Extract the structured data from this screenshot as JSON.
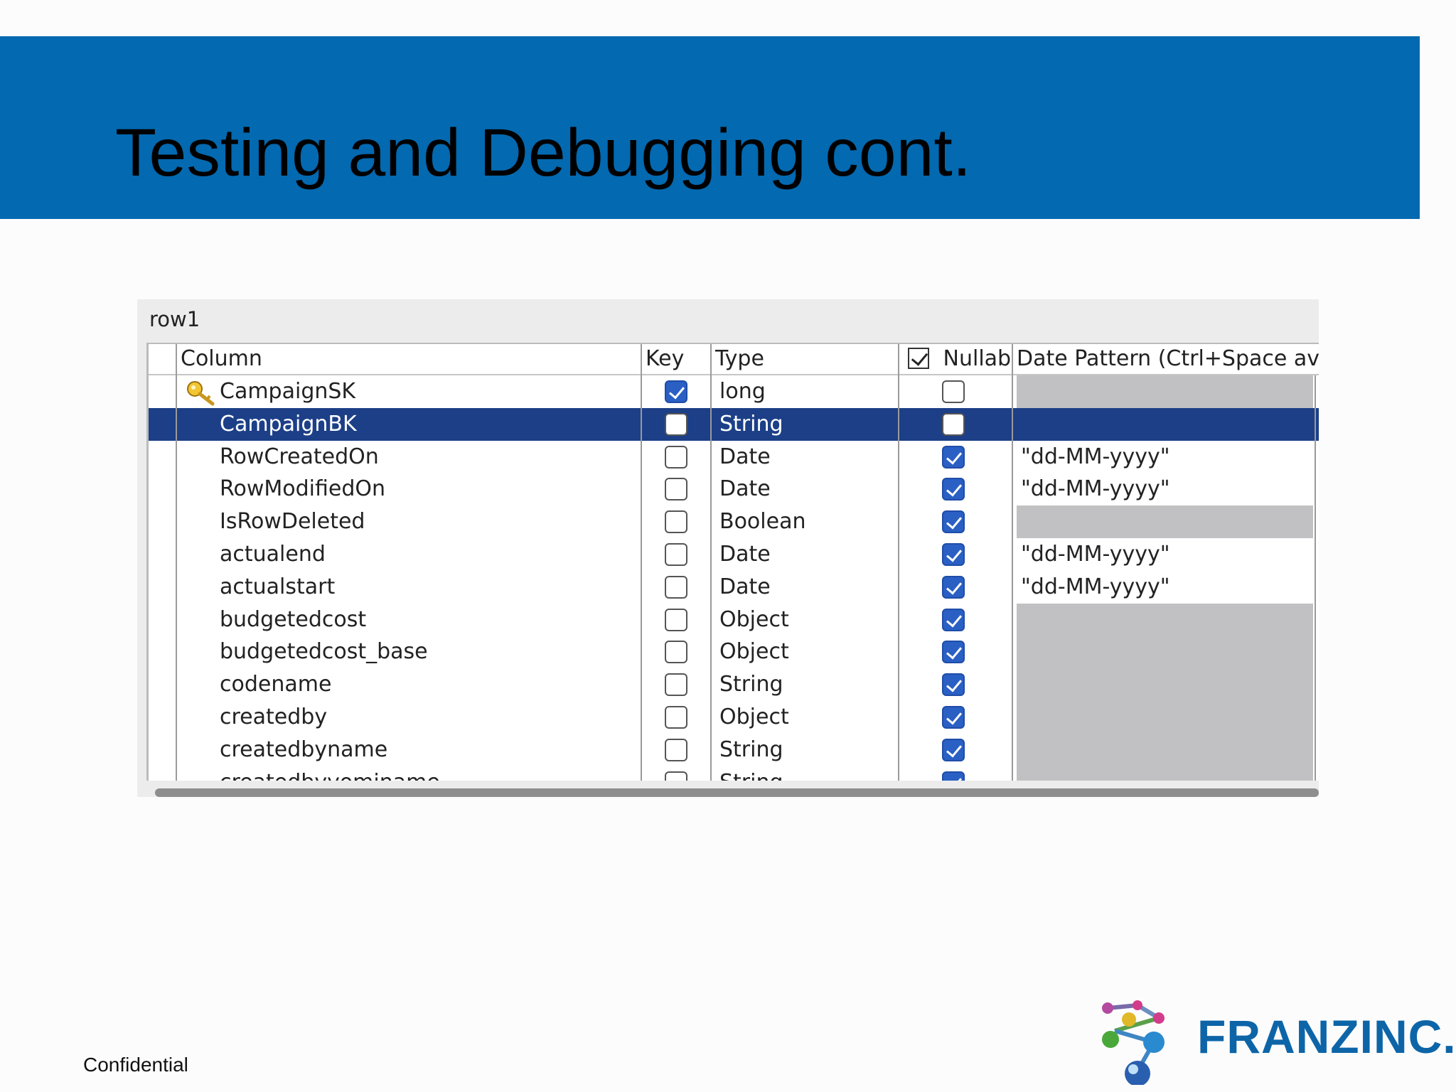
{
  "slide": {
    "title": "Testing and Debugging cont.",
    "footer": "Confidential",
    "logo_text": "FRANZINC."
  },
  "schema_panel": {
    "title": "row1",
    "columns": {
      "column": "Column",
      "key": "Key",
      "type": "Type",
      "nullable": "Nullab",
      "date_pattern": "Date Pattern (Ctrl+Space av"
    },
    "rows": [
      {
        "name": "CampaignSK",
        "key": true,
        "type": "long",
        "nullable": false,
        "date_pattern": "",
        "key_icon": "key-icon"
      },
      {
        "name": "CampaignBK",
        "key": false,
        "type": "String",
        "nullable": false,
        "date_pattern": "",
        "selected": true
      },
      {
        "name": "RowCreatedOn",
        "key": false,
        "type": "Date",
        "nullable": true,
        "date_pattern": "\"dd-MM-yyyy\""
      },
      {
        "name": "RowModifiedOn",
        "key": false,
        "type": "Date",
        "nullable": true,
        "date_pattern": "\"dd-MM-yyyy\""
      },
      {
        "name": "IsRowDeleted",
        "key": false,
        "type": "Boolean",
        "nullable": true,
        "date_pattern": ""
      },
      {
        "name": "actualend",
        "key": false,
        "type": "Date",
        "nullable": true,
        "date_pattern": "\"dd-MM-yyyy\""
      },
      {
        "name": "actualstart",
        "key": false,
        "type": "Date",
        "nullable": true,
        "date_pattern": "\"dd-MM-yyyy\""
      },
      {
        "name": "budgetedcost",
        "key": false,
        "type": "Object",
        "nullable": true,
        "date_pattern": ""
      },
      {
        "name": "budgetedcost_base",
        "key": false,
        "type": "Object",
        "nullable": true,
        "date_pattern": ""
      },
      {
        "name": "codename",
        "key": false,
        "type": "String",
        "nullable": true,
        "date_pattern": ""
      },
      {
        "name": "createdby",
        "key": false,
        "type": "Object",
        "nullable": true,
        "date_pattern": ""
      },
      {
        "name": "createdbyname",
        "key": false,
        "type": "String",
        "nullable": true,
        "date_pattern": ""
      },
      {
        "name": "createdbyyominame",
        "key": false,
        "type": "String",
        "nullable": true,
        "date_pattern": ""
      }
    ]
  },
  "colors": {
    "banner": "#0369b0",
    "selection": "#1c3f87",
    "checkbox_checked": "#2a5fc4"
  }
}
